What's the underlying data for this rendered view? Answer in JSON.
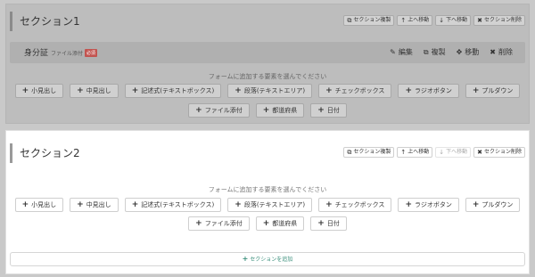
{
  "section_actions": {
    "duplicate": "セクション複製",
    "move_up": "上へ移動",
    "move_down": "下へ移動",
    "delete": "セクション削除"
  },
  "section1": {
    "title": "セクション1",
    "field": {
      "label": "身分証",
      "type": "ファイル添付",
      "required": "必須",
      "edit": "編集",
      "copy": "複製",
      "move": "移動",
      "delete": "削除"
    },
    "hint": "フォームに追加する要素を選んでください"
  },
  "section2": {
    "title": "セクション2",
    "hint": "フォームに追加する要素を選んでください"
  },
  "element_buttons": {
    "heading_small": "小見出し",
    "heading_medium": "中見出し",
    "textbox": "記述式(テキストボックス)",
    "textarea": "段落(テキストエリア)",
    "checkbox": "チェックボックス",
    "radio": "ラジオボタン",
    "dropdown": "プルダウン",
    "file": "ファイル添付",
    "prefecture": "都道府県",
    "date": "日付"
  },
  "add_section": "セクションを追加",
  "colors": {
    "accent": "#3a8f7b",
    "required": "#c25450"
  }
}
